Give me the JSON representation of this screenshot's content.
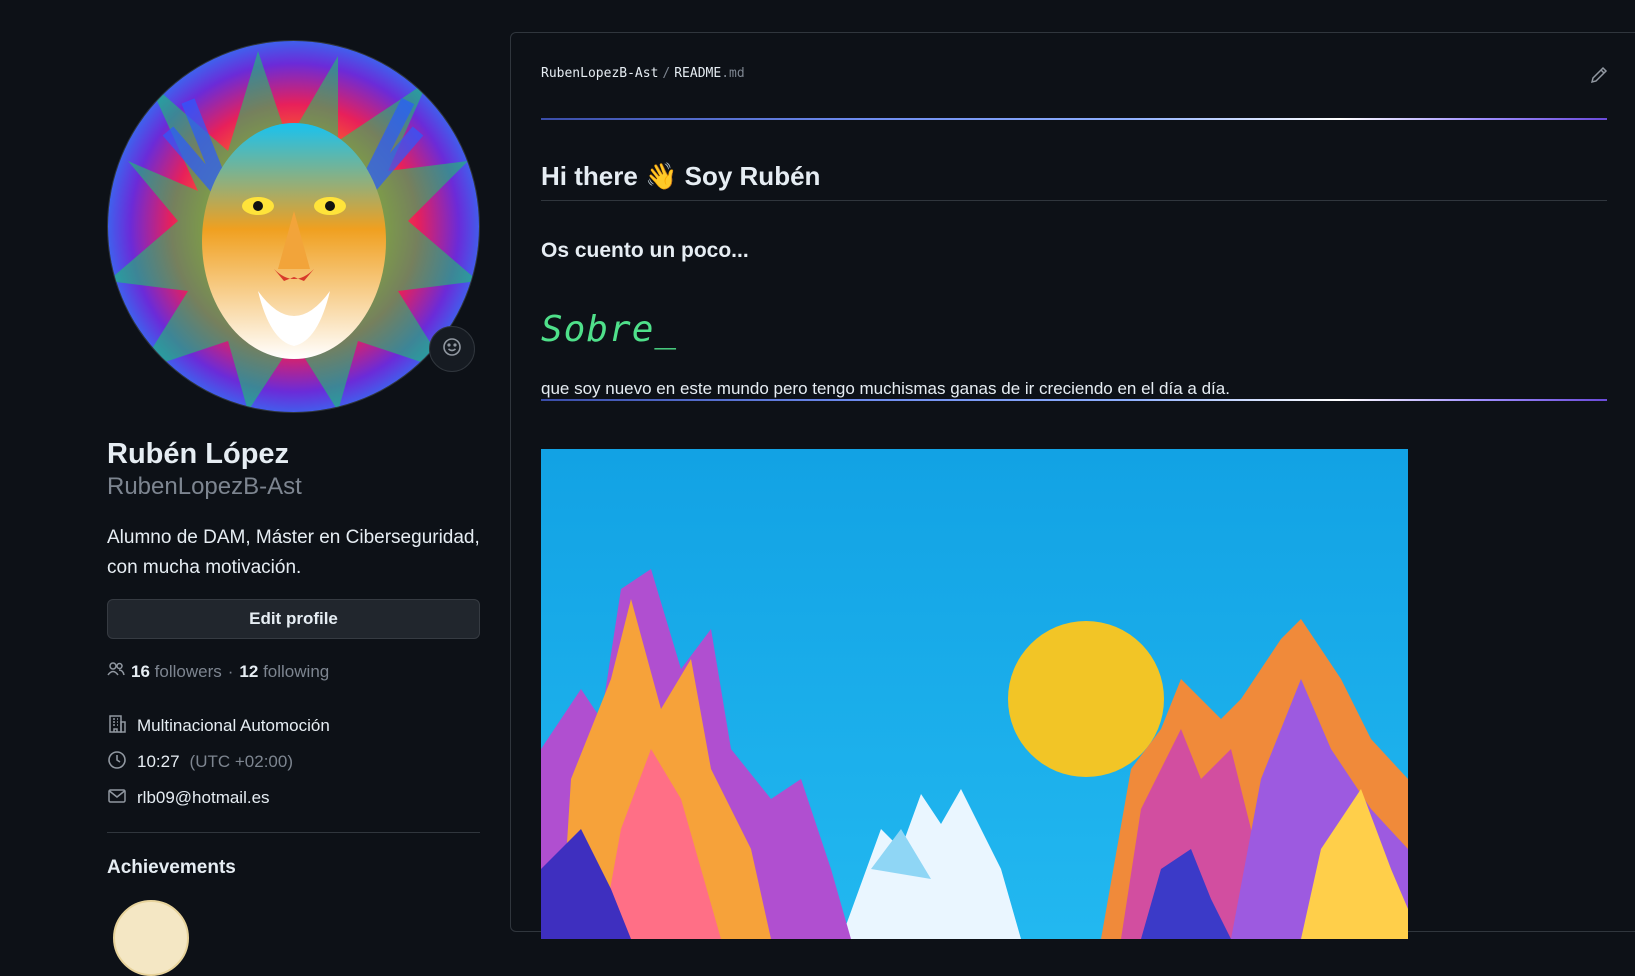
{
  "profile": {
    "name": "Rubén López",
    "login": "RubenLopezB-Ast",
    "bio": "Alumno de DAM, Máster en Ciberseguridad, con mucha motivación.",
    "edit_label": "Edit profile",
    "followers_count": "16",
    "followers_label": "followers",
    "separator": "·",
    "following_count": "12",
    "following_label": "following",
    "company": "Multinacional Automoción",
    "time": "10:27",
    "timezone": "(UTC +02:00)",
    "email": "rlb09@hotmail.es",
    "achievements_title": "Achievements"
  },
  "readme": {
    "owner": "RubenLopezB-Ast",
    "slash": "/",
    "file_base": "README",
    "file_ext": ".md",
    "heading": "Hi there 👋 Soy Rubén",
    "subheading": "Os cuento un poco...",
    "typing_text": "Sobre_",
    "paragraph": "que soy nuevo en este mundo pero tengo muchismas ganas de ir creciendo en el día a día."
  },
  "icons": {
    "status": "smiley-icon",
    "people": "people-icon",
    "org": "organization-icon",
    "clock": "clock-icon",
    "mail": "mail-icon",
    "edit": "pencil-icon"
  },
  "colors": {
    "background": "#0d1117",
    "text": "#e6edf3",
    "muted": "#7d8590",
    "border": "#30363d",
    "typing_green": "#4fe08a"
  }
}
